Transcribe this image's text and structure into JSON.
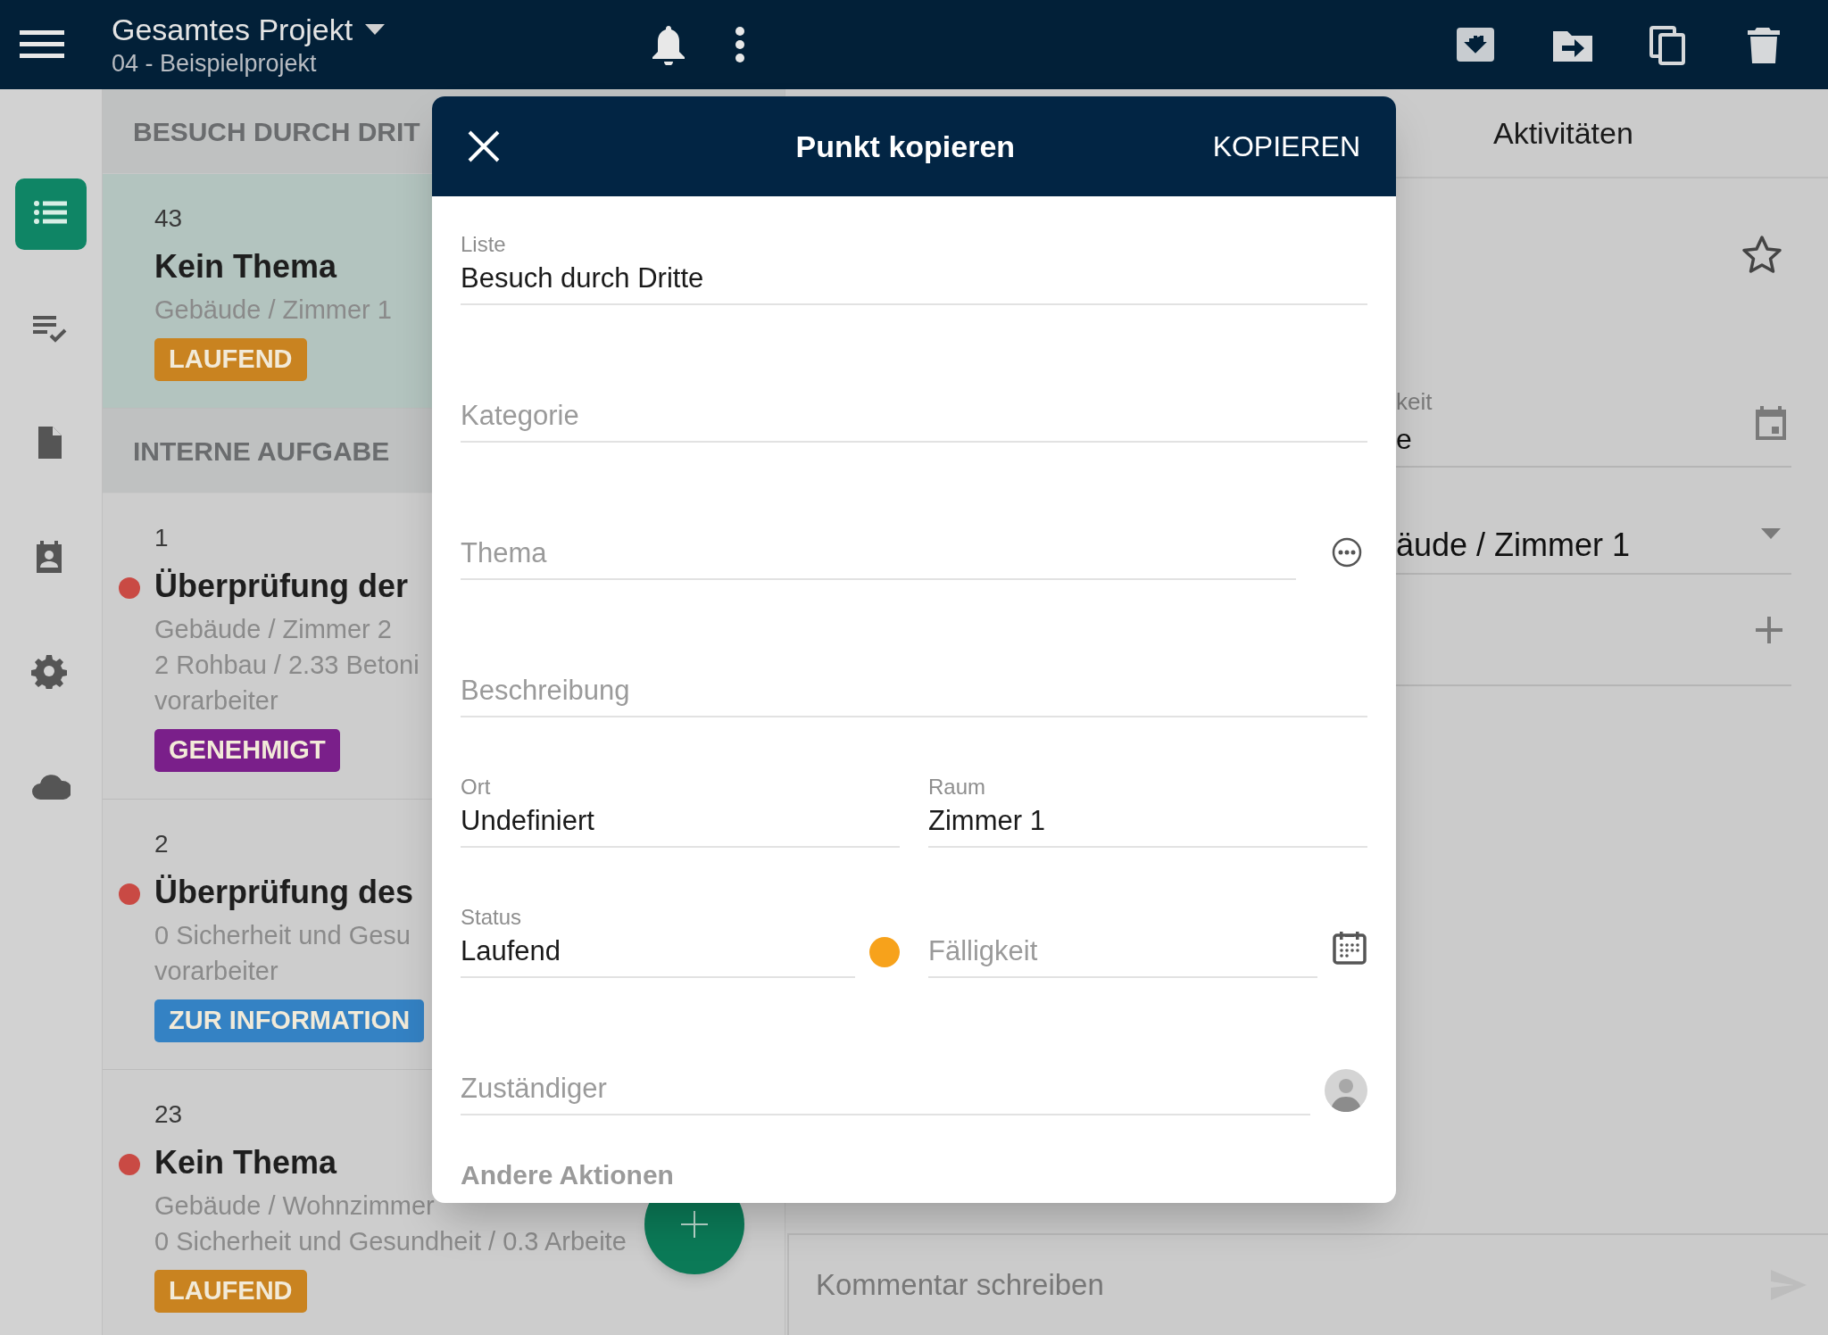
{
  "top_bar": {
    "title": "Gesamtes Projekt",
    "subtitle": "04 - Beispielprojekt",
    "actions": [
      {
        "kind": "archive"
      },
      {
        "kind": "move"
      },
      {
        "kind": "copy"
      },
      {
        "kind": "delete"
      }
    ]
  },
  "rail": [
    {
      "kind": "list",
      "selected": true
    },
    {
      "kind": "checklist",
      "selected": false
    },
    {
      "kind": "document",
      "selected": false
    },
    {
      "kind": "contacts",
      "selected": false
    },
    {
      "kind": "settings",
      "selected": false
    },
    {
      "kind": "cloud",
      "selected": false
    }
  ],
  "list": [
    {
      "header": "BESUCH DURCH DRIT",
      "items": [
        {
          "number": "43",
          "title": "Kein Thema",
          "lines": [
            "Gebäude / Zimmer 1"
          ],
          "badge": {
            "label": "LAUFEND",
            "color": "#c98320"
          },
          "flagged": false,
          "selected": true
        }
      ]
    },
    {
      "header": "INTERNE AUFGABE",
      "items": [
        {
          "number": "1",
          "title": "Überprüfung der",
          "lines": [
            "Gebäude / Zimmer 2",
            "2 Rohbau / 2.33 Betoni",
            "vorarbeiter"
          ],
          "badge": {
            "label": "GENEHMIGT",
            "color": "#7a1f8a"
          },
          "flagged": true,
          "selected": false
        },
        {
          "number": "2",
          "title": "Überprüfung des",
          "lines": [
            "0 Sicherheit und Gesu",
            "vorarbeiter"
          ],
          "badge": {
            "label": "ZUR INFORMATION",
            "color": "#3482c4"
          },
          "flagged": true,
          "selected": false
        },
        {
          "number": "23",
          "title": "Kein Thema",
          "lines": [
            "Gebäude / Wohnzimmer",
            "0 Sicherheit und Gesundheit / 0.3 Arbeite"
          ],
          "badge": {
            "label": "LAUFEND",
            "color": "#c98320"
          },
          "flagged": true,
          "selected": false
        }
      ]
    }
  ],
  "detail": {
    "tab": "Aktivitäten",
    "fields": [
      {
        "kind": "star"
      },
      {
        "kind": "date",
        "label": "keit",
        "value": "e"
      },
      {
        "kind": "select",
        "value": "äude / Zimmer 1"
      },
      {
        "kind": "add"
      }
    ],
    "comment": {
      "placeholder": "Kommentar schreiben"
    }
  },
  "dialog": {
    "title": "Punkt kopieren",
    "action": "KOPIEREN",
    "liste": {
      "label": "Liste",
      "value": "Besuch durch Dritte"
    },
    "kategorie": {
      "placeholder": "Kategorie"
    },
    "thema": {
      "placeholder": "Thema"
    },
    "beschreibung": {
      "placeholder": "Beschreibung"
    },
    "ort": {
      "label": "Ort",
      "value": "Undefiniert"
    },
    "raum": {
      "label": "Raum",
      "value": "Zimmer 1"
    },
    "status": {
      "label": "Status",
      "value": "Laufend",
      "color": "#f7a21b"
    },
    "faelligkeit": {
      "placeholder": "Fälligkeit"
    },
    "zustaendiger": {
      "placeholder": "Zuständiger"
    },
    "section": "Andere Aktionen"
  }
}
